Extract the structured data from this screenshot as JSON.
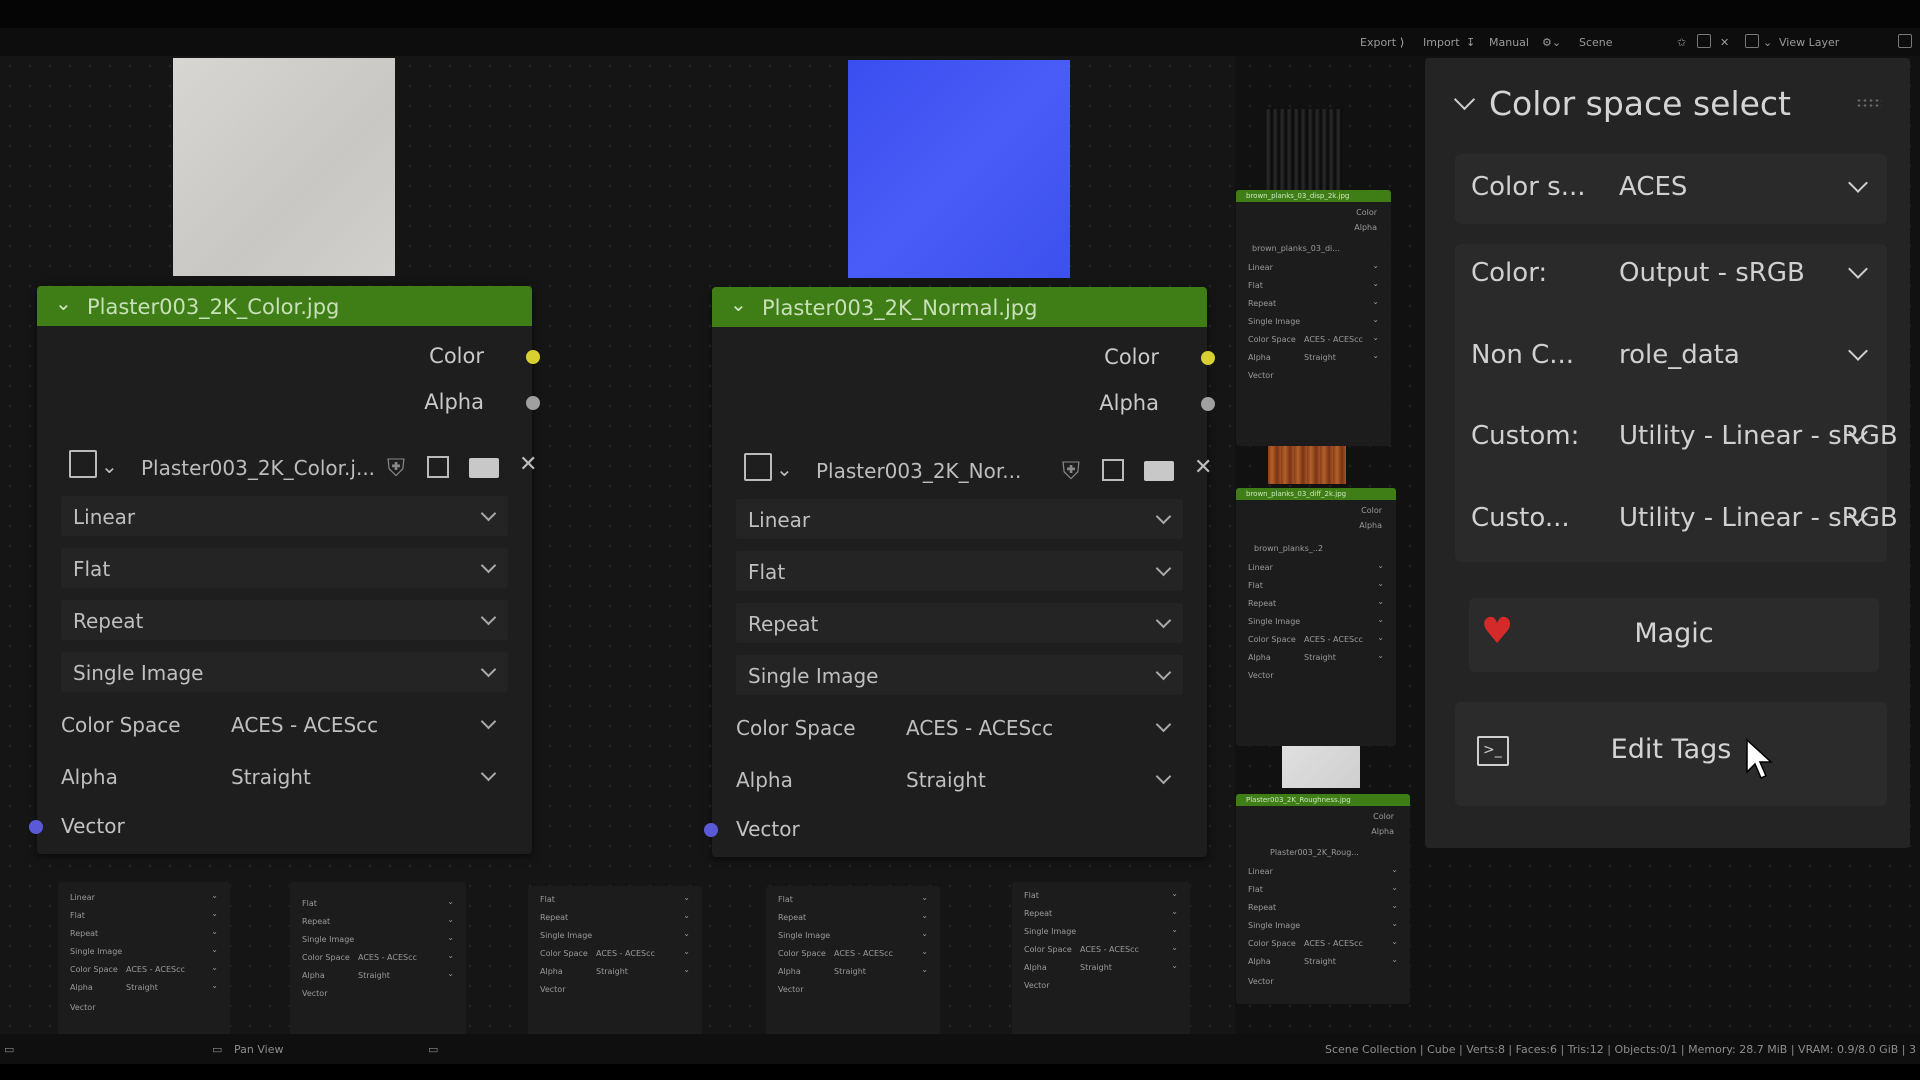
{
  "header": {
    "export": "Export",
    "import": "Import",
    "manual": "Manual",
    "scene": "Scene",
    "view_layer": "View Layer"
  },
  "colors": {
    "node_header": "#3f7d17",
    "socket_color": "#d8d030",
    "socket_alpha": "#a0a0a0",
    "socket_vector": "#5a5ad8",
    "heart": "#d42a2a"
  },
  "nodes": [
    {
      "title": "Plaster003_2K_Color.jpg",
      "out_color": "Color",
      "out_alpha": "Alpha",
      "image_name": "Plaster003_2K_Color.j...",
      "interpolation": "Linear",
      "projection": "Flat",
      "extension": "Repeat",
      "source": "Single Image",
      "color_space_label": "Color Space",
      "color_space": "ACES - ACEScc",
      "alpha_label": "Alpha",
      "alpha_mode": "Straight",
      "vector": "Vector"
    },
    {
      "title": "Plaster003_2K_Normal.jpg",
      "out_color": "Color",
      "out_alpha": "Alpha",
      "image_name": "Plaster003_2K_Nor...",
      "interpolation": "Linear",
      "projection": "Flat",
      "extension": "Repeat",
      "source": "Single Image",
      "color_space_label": "Color Space",
      "color_space": "ACES - ACEScc",
      "alpha_label": "Alpha",
      "alpha_mode": "Straight",
      "vector": "Vector"
    }
  ],
  "mini_nodes": {
    "n1_title": "brown_planks_03_disp_2k.jpg",
    "n1_image": "brown_planks_03_di...",
    "n2_title": "brown_planks_03_diff_2k.jpg",
    "n2_image": "brown_planks_...",
    "n2_users": "2",
    "n3_title": "Plaster003_2K_Roughness.jpg",
    "n3_image": "Plaster003_2K_Roug...",
    "color": "Color",
    "alpha": "Alpha",
    "linear": "Linear",
    "flat": "Flat",
    "repeat": "Repeat",
    "single_image": "Single Image",
    "color_space_label": "Color Space",
    "color_space": "ACES - ACEScc",
    "alpha_mode": "Straight",
    "vector": "Vector"
  },
  "panel": {
    "title": "Color space select",
    "rows": [
      {
        "label": "Color s...",
        "value": "ACES"
      },
      {
        "label": "Color:",
        "value": "Output - sRGB"
      },
      {
        "label": "Non C...",
        "value": "role_data"
      },
      {
        "label": "Custom:",
        "value": "Utility - Linear - sRGB"
      },
      {
        "label": "Custo...",
        "value": "Utility - Linear - sRGB"
      }
    ],
    "magic": "Magic",
    "edit_tags": "Edit Tags"
  },
  "statusbar": {
    "pan_view": "Pan View",
    "stats": "Scene Collection | Cube | Verts:8 | Faces:6 | Tris:12 | Objects:0/1 | Memory: 28.7 MiB | VRAM: 0.9/8.0 GiB | 3"
  }
}
